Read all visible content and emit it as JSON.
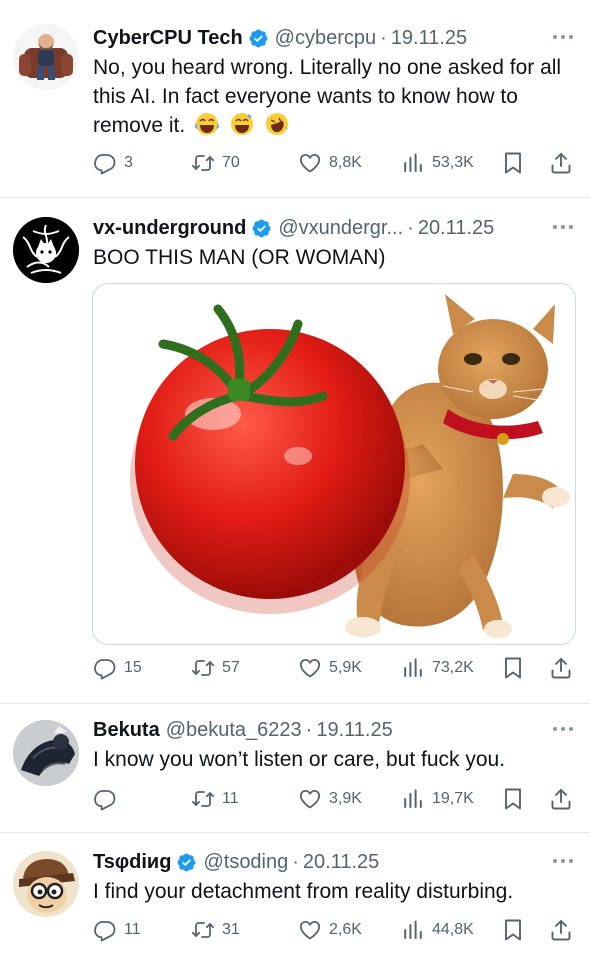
{
  "tweets": [
    {
      "name": "CyberCPU Tech",
      "verified": true,
      "handle": "@cybercpu",
      "dot": "·",
      "date": "19.11.25",
      "text": "No, you heard wrong. Literally no one asked for all this AI. In fact everyone wants to know how to remove it.",
      "emojis": [
        "face-with-tears-of-joy",
        "grinning-sweat-face",
        "rolling-on-floor-laughing"
      ],
      "replies": "3",
      "reposts": "70",
      "likes": "8,8K",
      "views": "53,3K"
    },
    {
      "name": "vx-underground",
      "verified": true,
      "handle": "@vxundergr...",
      "dot": "·",
      "date": "20.11.25",
      "text": "BOO THIS MAN (OR WOMAN)",
      "media": "cat-throwing-tomato",
      "replies": "15",
      "reposts": "57",
      "likes": "5,9K",
      "views": "73,2K"
    },
    {
      "name": "Bekuta",
      "verified": false,
      "handle": "@bekuta_6223",
      "dot": "·",
      "date": "19.11.25",
      "text": "I know you won’t listen or care, but fuck you.",
      "replies": "",
      "reposts": "11",
      "likes": "3,9K",
      "views": "19,7K"
    },
    {
      "name": "Tsφdiиg",
      "verified": true,
      "handle": "@tsoding",
      "dot": "·",
      "date": "20.11.25",
      "text": "I find your detachment from reality disturbing.",
      "replies": "11",
      "reposts": "31",
      "likes": "2,6K",
      "views": "44,8K"
    }
  ],
  "colors": {
    "text": "#0f1419",
    "muted": "#536471",
    "verified": "#1d9bf0",
    "divider": "#e6e9ec"
  }
}
